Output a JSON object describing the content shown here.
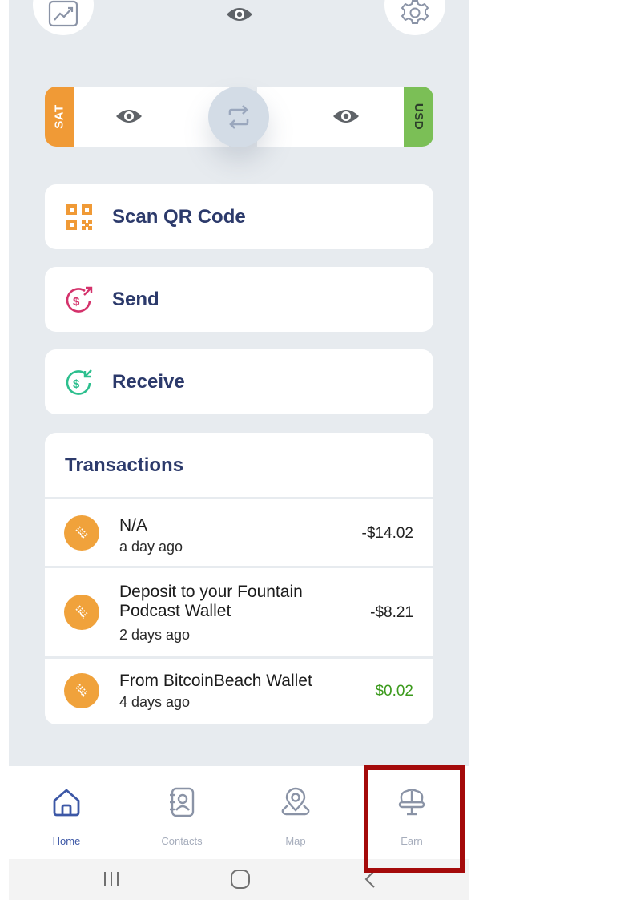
{
  "balance": {
    "left_currency": "SAT",
    "right_currency": "USD"
  },
  "actions": [
    {
      "label": "Scan QR Code",
      "icon": "qr-code-icon"
    },
    {
      "label": "Send",
      "icon": "send-money-icon"
    },
    {
      "label": "Receive",
      "icon": "receive-money-icon"
    }
  ],
  "transactions": {
    "title": "Transactions",
    "items": [
      {
        "description": "N/A",
        "time": "a day ago",
        "amount": "-$14.02"
      },
      {
        "description": "Deposit to your Fountain Podcast Wallet",
        "time": "2 days ago",
        "amount": "-$8.21"
      },
      {
        "description": "From BitcoinBeach Wallet",
        "time": "4 days ago",
        "amount": "$0.02"
      }
    ]
  },
  "nav": [
    {
      "label": "Home",
      "icon": "home-icon"
    },
    {
      "label": "Contacts",
      "icon": "contacts-icon"
    },
    {
      "label": "Map",
      "icon": "map-icon"
    },
    {
      "label": "Earn",
      "icon": "earn-icon"
    }
  ],
  "colors": {
    "background": "#e7ebef",
    "primary_text": "#2c3a6b",
    "sat": "#f09a36",
    "usd": "#7bbf56",
    "positive": "#3b9a1c",
    "highlight": "#a40a0a"
  }
}
